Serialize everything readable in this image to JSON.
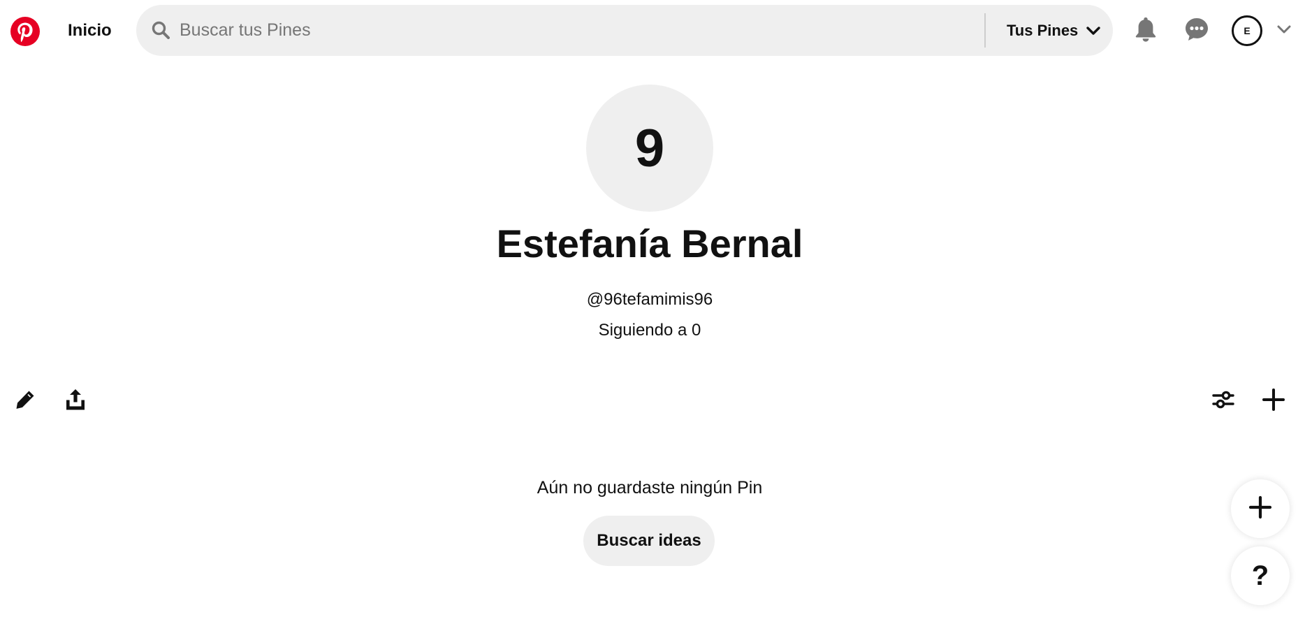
{
  "brand": {
    "logo_icon": "pinterest-logo",
    "accent_color": "#e60023"
  },
  "header": {
    "home_label": "Inicio",
    "search": {
      "placeholder": "Buscar tus Pines",
      "value": ""
    },
    "scope_label": "Tus Pines",
    "icons": [
      "search-icon",
      "chevron-down-icon",
      "bell-icon",
      "messages-icon",
      "chevron-down-icon"
    ],
    "avatar_initial": "E"
  },
  "profile": {
    "avatar_text": "9",
    "name": "Estefanía Bernal",
    "username": "@96tefamimis96",
    "following_text": "Siguiendo a 0"
  },
  "actions": {
    "left": [
      "edit-icon",
      "share-icon"
    ],
    "right": [
      "filter-icon",
      "plus-icon"
    ]
  },
  "empty_state": {
    "message": "Aún no guardaste ningún Pin",
    "button_label": "Buscar ideas"
  },
  "floating": {
    "add_icon": "plus-icon",
    "help_label": "?"
  }
}
